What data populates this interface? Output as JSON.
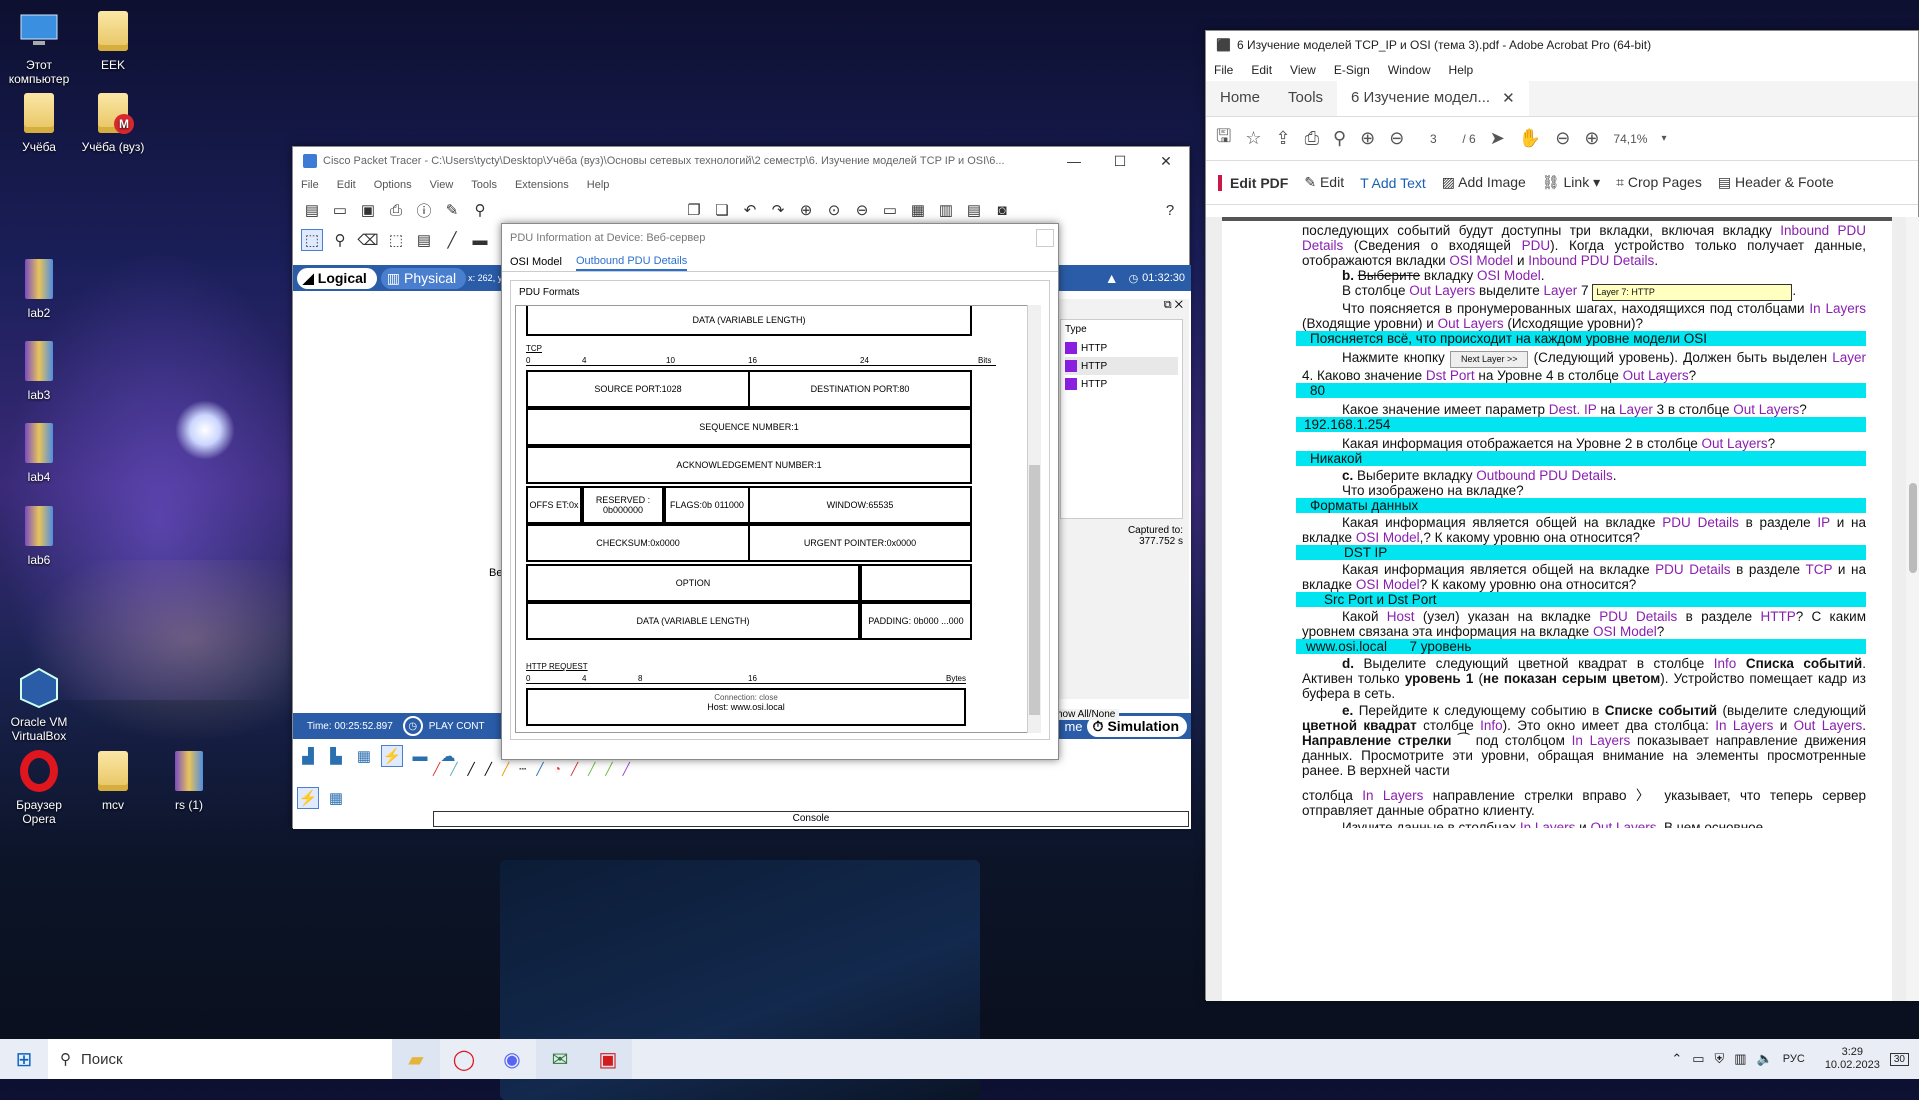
{
  "desktop": {
    "icons": [
      {
        "label": "Этот компьютер",
        "icon": "computer-icon"
      },
      {
        "label": "EEK",
        "icon": "folder-icon"
      },
      {
        "label": "Учёба",
        "icon": "folder-icon"
      },
      {
        "label": "Учёба (вуз)",
        "icon": "folder-mega-icon"
      },
      {
        "label": "lab2",
        "icon": "winrar-icon"
      },
      {
        "label": "lab3",
        "icon": "winrar-icon"
      },
      {
        "label": "lab4",
        "icon": "winrar-icon"
      },
      {
        "label": "lab6",
        "icon": "winrar-icon"
      },
      {
        "label": "Oracle VM VirtualBox",
        "icon": "virtualbox-icon"
      },
      {
        "label": "Браузер Opera",
        "icon": "opera-icon"
      },
      {
        "label": "mcv",
        "icon": "folder-icon"
      },
      {
        "label": "rs (1)",
        "icon": "winrar-icon"
      }
    ]
  },
  "cpt": {
    "title": "Cisco Packet Tracer - C:\\Users\\tycty\\Desktop\\Учёба (вуз)\\Основы сетевых технологий\\2 семестр\\6. Изучение моделей TCP IP и OSI\\6...",
    "menu": [
      "File",
      "Edit",
      "Options",
      "View",
      "Tools",
      "Extensions",
      "Help"
    ],
    "logical_label": "Logical",
    "physical_label": "Physical",
    "coords": "x: 262, y",
    "clock": "01:32:30",
    "time_label": "Time: 00:25:52.897",
    "play_label": "PLAY CONT",
    "event_list": {
      "type_header": "Type",
      "types": [
        "HTTP",
        "HTTP",
        "HTTP"
      ],
      "captured_label": "Captured to:",
      "captured_value": "377.752 s"
    },
    "show_all": "how All/None",
    "sim_short": "me",
    "simulation_label": "Simulation",
    "console_label": "Console",
    "cut_text": "Be"
  },
  "pdu": {
    "title": "PDU Information at Device: Веб-сервер",
    "tabs": [
      "OSI Model",
      "Outbound PDU Details"
    ],
    "formats_label": "PDU Formats",
    "top_field": "DATA (VARIABLE LENGTH)",
    "tcp_label": "TCP",
    "tcp_ruler": [
      "0",
      "4",
      "10",
      "16",
      "24",
      "Bits"
    ],
    "src_port": "SOURCE PORT:1028",
    "dst_port": "DESTINATION PORT:80",
    "seq": "SEQUENCE NUMBER:1",
    "ack": "ACKNOWLEDGEMENT NUMBER:1",
    "offset": "OFFS ET:0x",
    "reserved": "RESERVED : 0b000000",
    "flags": "FLAGS:0b 011000",
    "window": "WINDOW:65535",
    "checksum": "CHECKSUM:0x0000",
    "urgent": "URGENT POINTER:0x0000",
    "option": "OPTION",
    "data": "DATA (VARIABLE LENGTH)",
    "padding": "PADDING: 0b000 ...000",
    "http_label": "HTTP REQUEST",
    "http_ruler": [
      "0",
      "4",
      "8",
      "16",
      "Bytes"
    ],
    "http_line1": "Connection: close",
    "http_line2": "Host: www.osi.local"
  },
  "acrobat": {
    "title": "6 Изучение моделей TCP_IP и OSI (тема 3).pdf - Adobe Acrobat Pro (64-bit)",
    "menu": [
      "File",
      "Edit",
      "View",
      "E-Sign",
      "Window",
      "Help"
    ],
    "tabs": {
      "home": "Home",
      "tools": "Tools",
      "doc": "6 Изучение модел..."
    },
    "page_current": "3",
    "page_total": "/ 6",
    "zoom": "74,1%",
    "edit_pdf": "Edit PDF",
    "edit_tools": [
      "Edit",
      "Add Text",
      "Add Image",
      "Link",
      "Crop Pages",
      "Header & Foote"
    ],
    "tooltip_layer7": "Layer 7: HTTP",
    "next_layer_btn": "Next Layer >>"
  },
  "taskbar": {
    "search": "Поиск",
    "lang": "РУС",
    "time": "3:29",
    "date": "10.02.2023",
    "notif": "30"
  }
}
